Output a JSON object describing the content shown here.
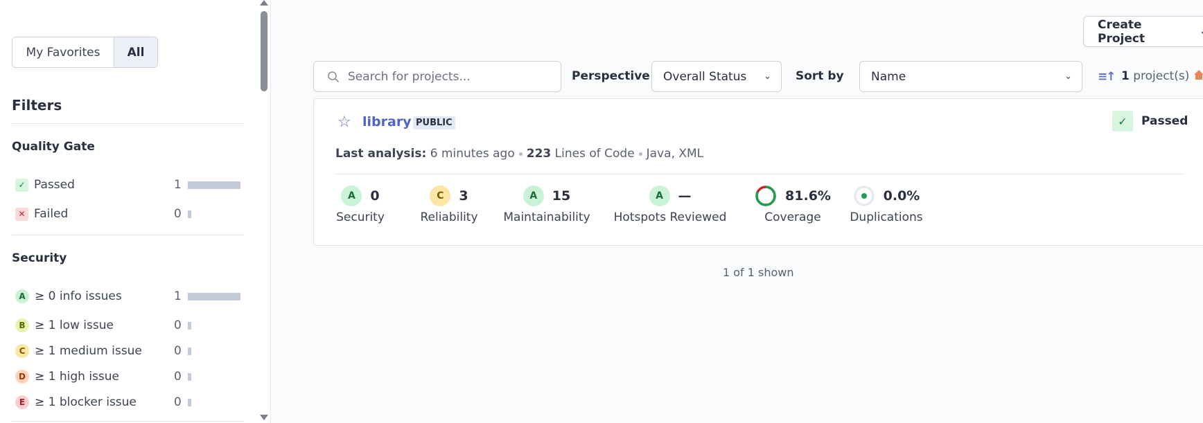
{
  "sidebar": {
    "favorites_label": "My Favorites",
    "all_label": "All",
    "filters_title": "Filters",
    "quality_gate": {
      "title": "Quality Gate",
      "items": [
        {
          "label": "Passed",
          "count": "1",
          "fraction": 1.0
        },
        {
          "label": "Failed",
          "count": "0",
          "fraction": 0.0
        }
      ]
    },
    "security": {
      "title": "Security",
      "items": [
        {
          "rating": "A",
          "label": "≥ 0 info issues",
          "count": "1",
          "fraction": 1.0
        },
        {
          "rating": "B",
          "label": "≥ 1 low issue",
          "count": "0",
          "fraction": 0.0
        },
        {
          "rating": "C",
          "label": "≥ 1 medium issue",
          "count": "0",
          "fraction": 0.0
        },
        {
          "rating": "D",
          "label": "≥ 1 high issue",
          "count": "0",
          "fraction": 0.0
        },
        {
          "rating": "E",
          "label": "≥ 1 blocker issue",
          "count": "0",
          "fraction": 0.0
        }
      ]
    }
  },
  "header": {
    "create_project_label": "Create Project",
    "search_placeholder": "Search for projects...",
    "perspective_label": "Perspective",
    "perspective_value": "Overall Status",
    "sort_by_label": "Sort by",
    "sort_value": "Name",
    "project_count": "1",
    "project_count_suffix": "project(s)"
  },
  "project": {
    "name": "library",
    "visibility": "PUBLIC",
    "status": "Passed",
    "last_analysis_label": "Last analysis:",
    "last_analysis_value": "6 minutes ago",
    "lines_of_code_value": "223",
    "lines_of_code_label": "Lines of Code",
    "languages": "Java, XML",
    "measures": [
      {
        "rating": "A",
        "value": "0",
        "label": "Security"
      },
      {
        "rating": "C",
        "value": "3",
        "label": "Reliability"
      },
      {
        "rating": "A",
        "value": "15",
        "label": "Maintainability"
      },
      {
        "rating": "A",
        "value": "—",
        "label": "Hotspots Reviewed"
      }
    ],
    "coverage": {
      "value": "81.6%",
      "label": "Coverage",
      "percent": 81.6
    },
    "duplications": {
      "value": "0.0%",
      "label": "Duplications",
      "percent": 0.0
    }
  },
  "footer": {
    "shown_text": "1 of 1 shown"
  },
  "colors": {
    "accent": "#5c6fd1",
    "passed_bg": "#d8f5e0",
    "failed_bg": "#fbd9da",
    "coverage_good": "#1f9e4f",
    "coverage_bad": "#c1262c"
  }
}
